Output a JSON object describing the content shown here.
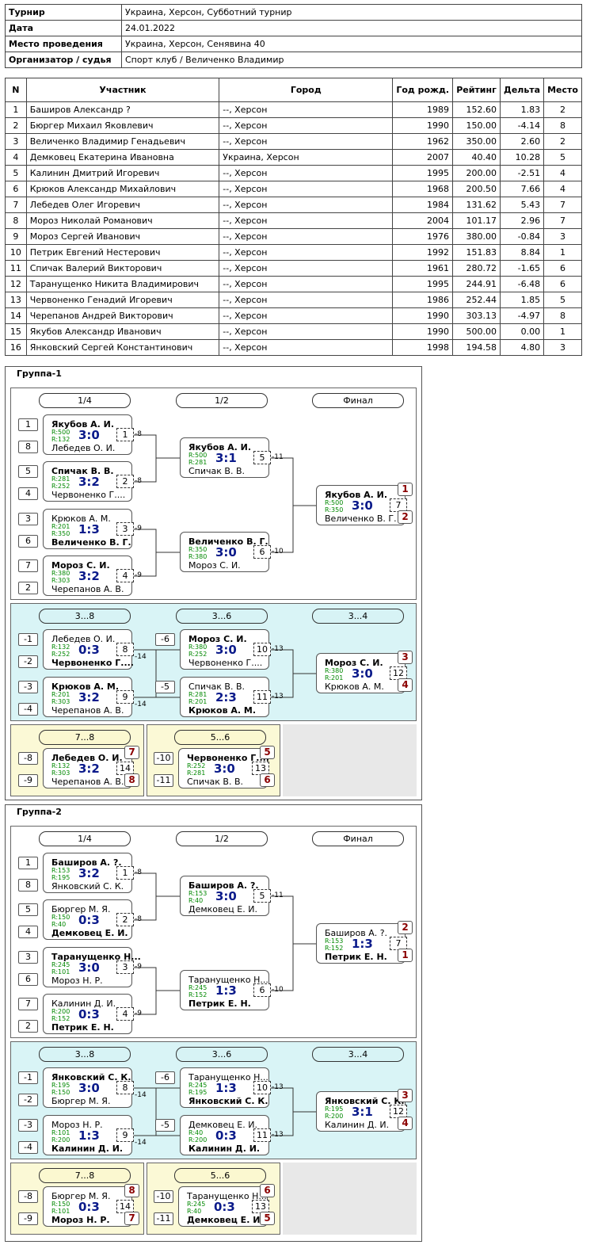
{
  "info": [
    {
      "label": "Турнир",
      "value": "Украина, Херсон, Субботний турнир"
    },
    {
      "label": "Дата",
      "value": "24.01.2022"
    },
    {
      "label": "Место проведения",
      "value": "Украина, Херсон, Сенявина 40"
    },
    {
      "label": "Организатор / судья",
      "value": "Спорт клуб / Величенко Владимир"
    }
  ],
  "players_header": [
    "N",
    "Участник",
    "Город",
    "Год рожд.",
    "Рейтинг",
    "Дельта",
    "Место"
  ],
  "players": [
    [
      "1",
      "Баширов Александр ?",
      "--, Херсон",
      "1989",
      "152.60",
      "1.83",
      "2"
    ],
    [
      "2",
      "Бюргер Михаил Яковлевич",
      "--, Херсон",
      "1990",
      "150.00",
      "-4.14",
      "8"
    ],
    [
      "3",
      "Величенко Владимир Генадьевич",
      "--, Херсон",
      "1962",
      "350.00",
      "2.60",
      "2"
    ],
    [
      "4",
      "Демковец Екатерина Ивановна",
      "Украина, Херсон",
      "2007",
      "40.40",
      "10.28",
      "5"
    ],
    [
      "5",
      "Калинин Дмитрий Игоревич",
      "--, Херсон",
      "1995",
      "200.00",
      "-2.51",
      "4"
    ],
    [
      "6",
      "Крюков Александр Михайлович",
      "--, Херсон",
      "1968",
      "200.50",
      "7.66",
      "4"
    ],
    [
      "7",
      "Лебедев Олег Игоревич",
      "--, Херсон",
      "1984",
      "131.62",
      "5.43",
      "7"
    ],
    [
      "8",
      "Мороз Николай Романович",
      "--, Херсон",
      "2004",
      "101.17",
      "2.96",
      "7"
    ],
    [
      "9",
      "Мороз Сергей Иванович",
      "--, Херсон",
      "1976",
      "380.00",
      "-0.84",
      "3"
    ],
    [
      "10",
      "Петрик Евгений Нестерович",
      "--, Херсон",
      "1992",
      "151.83",
      "8.84",
      "1"
    ],
    [
      "11",
      "Спичак Валерий Викторович",
      "--, Херсон",
      "1961",
      "280.72",
      "-1.65",
      "6"
    ],
    [
      "12",
      "Таранущенко Никита Владимирович",
      "--, Херсон",
      "1995",
      "244.91",
      "-6.48",
      "6"
    ],
    [
      "13",
      "Червоненко Генадий Игоревич",
      "--, Херсон",
      "1986",
      "252.44",
      "1.85",
      "5"
    ],
    [
      "14",
      "Черепанов Андрей Викторович",
      "--, Херсон",
      "1990",
      "303.13",
      "-4.97",
      "8"
    ],
    [
      "15",
      "Якубов Александр Иванович",
      "--, Херсон",
      "1990",
      "500.00",
      "0.00",
      "1"
    ],
    [
      "16",
      "Янковский Сергей Константинович",
      "--, Херсон",
      "1998",
      "194.58",
      "4.80",
      "3"
    ]
  ],
  "groups": [
    {
      "title": "Группа-1",
      "rounds": {
        "r1": "1/4",
        "r2": "1/2",
        "r3": "Финал",
        "r4": "3...8",
        "r5": "3...6",
        "r6": "3...4",
        "r7": "7...8",
        "r8": "5...6"
      },
      "matches": [
        {
          "p1": "Якубов А. И.",
          "p2": "Лебедев О. И.",
          "r1": "R:500",
          "r2": "R:132",
          "score": "3:0",
          "no": "1",
          "win": 1,
          "s1": "1",
          "s2": "8",
          "next": "-8"
        },
        {
          "p1": "Спичак В. В.",
          "p2": "Червоненко Г....",
          "r1": "R:281",
          "r2": "R:252",
          "score": "3:2",
          "no": "2",
          "win": 1,
          "s1": "5",
          "s2": "4",
          "next": "-8"
        },
        {
          "p1": "Крюков А. М.",
          "p2": "Величенко В. Г.",
          "r1": "R:201",
          "r2": "R:350",
          "score": "1:3",
          "no": "3",
          "win": 2,
          "s1": "3",
          "s2": "6",
          "next": "-9"
        },
        {
          "p1": "Мороз С. И.",
          "p2": "Черепанов А. В.",
          "r1": "R:380",
          "r2": "R:303",
          "score": "3:2",
          "no": "4",
          "win": 1,
          "s1": "7",
          "s2": "2",
          "next": "-9"
        },
        {
          "p1": "Якубов А. И.",
          "p2": "Спичак В. В.",
          "r1": "R:500",
          "r2": "R:281",
          "score": "3:1",
          "no": "5",
          "win": 1,
          "next": "-11"
        },
        {
          "p1": "Величенко В. Г.",
          "p2": "Мороз С. И.",
          "r1": "R:350",
          "r2": "R:380",
          "score": "3:0",
          "no": "6",
          "win": 1,
          "next": "-10"
        },
        {
          "p1": "Якубов А. И.",
          "p2": "Величенко В. Г.",
          "r1": "R:500",
          "r2": "R:350",
          "score": "3:0",
          "no": "7",
          "win": 1,
          "pl1": "1",
          "pl2": "2"
        },
        {
          "p1": "Лебедев О. И.",
          "p2": "Червоненко Г....",
          "r1": "R:132",
          "r2": "R:252",
          "score": "0:3",
          "no": "8",
          "win": 2,
          "s1": "-1",
          "s2": "-2",
          "next": "-14"
        },
        {
          "p1": "Крюков А. М.",
          "p2": "Черепанов А. В.",
          "r1": "R:201",
          "r2": "R:303",
          "score": "3:2",
          "no": "9",
          "win": 1,
          "s1": "-3",
          "s2": "-4",
          "next": "-14"
        },
        {
          "p1": "Мороз С. И.",
          "p2": "Червоненко Г....",
          "r1": "R:380",
          "r2": "R:252",
          "score": "3:0",
          "no": "10",
          "win": 1,
          "s1": "-6",
          "next": "-13"
        },
        {
          "p1": "Спичак В. В.",
          "p2": "Крюков А. М.",
          "r1": "R:281",
          "r2": "R:201",
          "score": "2:3",
          "no": "11",
          "win": 2,
          "s1": "-5",
          "next": "-13"
        },
        {
          "p1": "Мороз С. И.",
          "p2": "Крюков А. М.",
          "r1": "R:380",
          "r2": "R:201",
          "score": "3:0",
          "no": "12",
          "win": 1,
          "pl1": "3",
          "pl2": "4"
        },
        {
          "p1": "Лебедев О. И.",
          "p2": "Черепанов А. В.",
          "r1": "R:132",
          "r2": "R:303",
          "score": "3:2",
          "no": "14",
          "win": 1,
          "s1": "-8",
          "s2": "-9",
          "pl1": "7",
          "pl2": "8"
        },
        {
          "p1": "Червоненко Г....",
          "p2": "Спичак В. В.",
          "r1": "R:252",
          "r2": "R:281",
          "score": "3:0",
          "no": "13",
          "win": 1,
          "s1": "-10",
          "s2": "-11",
          "pl1": "5",
          "pl2": "6"
        }
      ]
    },
    {
      "title": "Группа-2",
      "rounds": {
        "r1": "1/4",
        "r2": "1/2",
        "r3": "Финал",
        "r4": "3...8",
        "r5": "3...6",
        "r6": "3...4",
        "r7": "7...8",
        "r8": "5...6"
      },
      "matches": [
        {
          "p1": "Баширов А. ?.",
          "p2": "Янковский С. К.",
          "r1": "R:153",
          "r2": "R:195",
          "score": "3:2",
          "no": "1",
          "win": 1,
          "s1": "1",
          "s2": "8",
          "next": "-8"
        },
        {
          "p1": "Бюргер М. Я.",
          "p2": "Демковец Е. И.",
          "r1": "R:150",
          "r2": "R:40",
          "score": "0:3",
          "no": "2",
          "win": 2,
          "s1": "5",
          "s2": "4",
          "next": "-8"
        },
        {
          "p1": "Таранущенко Н...",
          "p2": "Мороз Н. Р.",
          "r1": "R:245",
          "r2": "R:101",
          "score": "3:0",
          "no": "3",
          "win": 1,
          "s1": "3",
          "s2": "6",
          "next": "-9"
        },
        {
          "p1": "Калинин Д. И.",
          "p2": "Петрик Е. Н.",
          "r1": "R:200",
          "r2": "R:152",
          "score": "0:3",
          "no": "4",
          "win": 2,
          "s1": "7",
          "s2": "2",
          "next": "-9"
        },
        {
          "p1": "Баширов А. ?.",
          "p2": "Демковец Е. И.",
          "r1": "R:153",
          "r2": "R:40",
          "score": "3:0",
          "no": "5",
          "win": 1,
          "next": "-11"
        },
        {
          "p1": "Таранущенко Н...",
          "p2": "Петрик Е. Н.",
          "r1": "R:245",
          "r2": "R:152",
          "score": "1:3",
          "no": "6",
          "win": 2,
          "next": "-10"
        },
        {
          "p1": "Баширов А. ?.",
          "p2": "Петрик Е. Н.",
          "r1": "R:153",
          "r2": "R:152",
          "score": "1:3",
          "no": "7",
          "win": 2,
          "pl1": "2",
          "pl2": "1"
        },
        {
          "p1": "Янковский С. К.",
          "p2": "Бюргер М. Я.",
          "r1": "R:195",
          "r2": "R:150",
          "score": "3:0",
          "no": "8",
          "win": 1,
          "s1": "-1",
          "s2": "-2",
          "next": "-14"
        },
        {
          "p1": "Мороз Н. Р.",
          "p2": "Калинин Д. И.",
          "r1": "R:101",
          "r2": "R:200",
          "score": "1:3",
          "no": "9",
          "win": 2,
          "s1": "-3",
          "s2": "-4",
          "next": "-14"
        },
        {
          "p1": "Таранущенко Н...",
          "p2": "Янковский С. К.",
          "r1": "R:245",
          "r2": "R:195",
          "score": "1:3",
          "no": "10",
          "win": 2,
          "s1": "-6",
          "next": "-13"
        },
        {
          "p1": "Демковец Е. И.",
          "p2": "Калинин Д. И.",
          "r1": "R:40",
          "r2": "R:200",
          "score": "0:3",
          "no": "11",
          "win": 2,
          "s1": "-5",
          "next": "-13"
        },
        {
          "p1": "Янковский С. К.",
          "p2": "Калинин Д. И.",
          "r1": "R:195",
          "r2": "R:200",
          "score": "3:1",
          "no": "12",
          "win": 1,
          "pl1": "3",
          "pl2": "4"
        },
        {
          "p1": "Бюргер М. Я.",
          "p2": "Мороз Н. Р.",
          "r1": "R:150",
          "r2": "R:101",
          "score": "0:3",
          "no": "14",
          "win": 2,
          "s1": "-8",
          "s2": "-9",
          "pl1": "8",
          "pl2": "7"
        },
        {
          "p1": "Таранущенко Н...",
          "p2": "Демковец Е. И.",
          "r1": "R:245",
          "r2": "R:40",
          "score": "0:3",
          "no": "13",
          "win": 2,
          "s1": "-10",
          "s2": "-11",
          "pl1": "6",
          "pl2": "5"
        }
      ]
    }
  ]
}
